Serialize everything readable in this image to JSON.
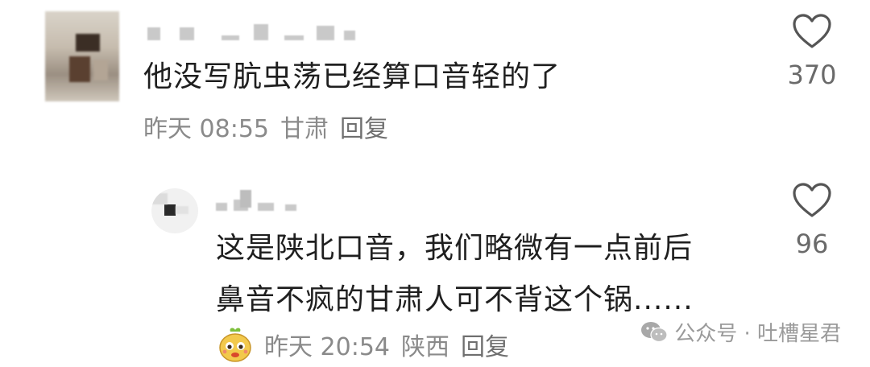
{
  "comments": [
    {
      "text": "他没写肮虫荡已经算口音轻的了",
      "time": "昨天 08:55",
      "location": "甘肃",
      "reply_label": "回复",
      "likes": "370",
      "icons": {
        "like": "heart-icon",
        "avatar": "blurred-avatar"
      }
    },
    {
      "text_line1": "这是陕北口音，我们略微有一点前后",
      "text_line2": "鼻音不疯的甘肃人可不背这个锅......",
      "time": "昨天 20:54",
      "location": "陕西",
      "reply_label": "回复",
      "likes": "96",
      "icons": {
        "like": "heart-icon",
        "avatar": "blurred-avatar",
        "badge": "mascot-icon"
      }
    }
  ],
  "watermark": {
    "text": "公众号 · 吐槽星君",
    "icon": "wechat-icon"
  },
  "colors": {
    "text": "#1f1f1f",
    "meta": "#8a8a8a",
    "like": "#6a6a6a",
    "watermark": "#9a9a9a"
  }
}
